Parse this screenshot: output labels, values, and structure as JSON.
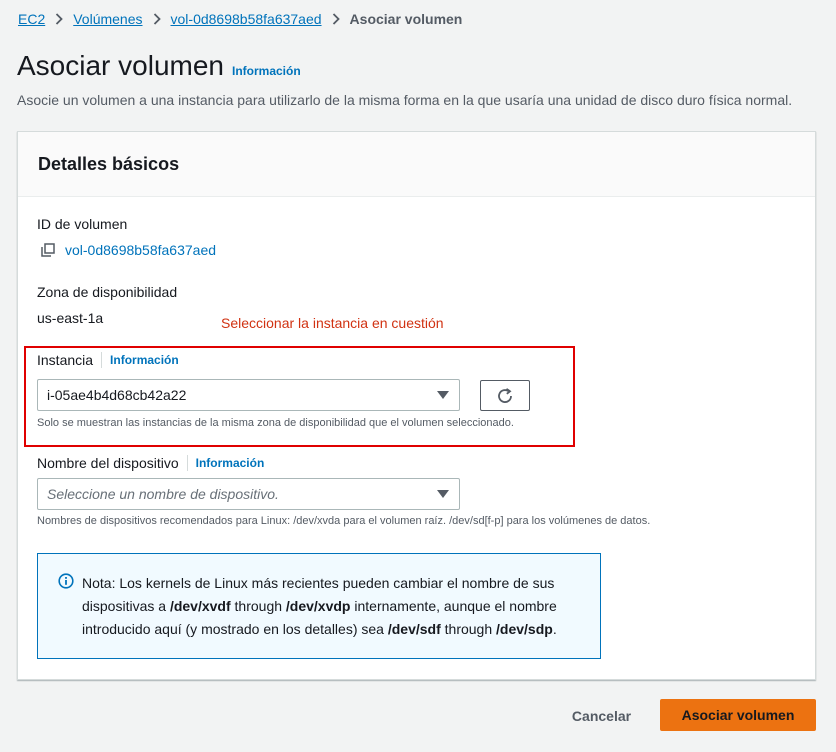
{
  "breadcrumb": {
    "items": [
      "EC2",
      "Volúmenes",
      "vol-0d8698b58fa637aed"
    ],
    "current": "Asociar volumen"
  },
  "header": {
    "title": "Asociar volumen",
    "info": "Información",
    "description": "Asocie un volumen a una instancia para utilizarlo de la misma forma en la que usaría una unidad de disco duro física normal."
  },
  "section": {
    "title": "Detalles básicos",
    "volume_id_label": "ID de volumen",
    "volume_id": "vol-0d8698b58fa637aed",
    "az_label": "Zona de disponibilidad",
    "az_value": "us-east-1a",
    "annotation": "Seleccionar la instancia en cuestión",
    "instance_label": "Instancia",
    "instance_info": "Información",
    "instance_value": "i-05ae4b4d68cb42a22",
    "instance_hint": "Solo se muestran las instancias de la misma zona de disponibilidad que el volumen seleccionado.",
    "device_label": "Nombre del dispositivo",
    "device_info": "Información",
    "device_placeholder": "Seleccione un nombre de dispositivo.",
    "device_hint": "Nombres de dispositivos recomendados para Linux: /dev/xvda para el volumen raíz. /dev/sd[f-p] para los volúmenes de datos."
  },
  "alert": {
    "t1": "Nota: Los kernels de Linux más recientes pueden cambiar el nombre de sus dispositivas a ",
    "b1": "/dev/xvdf",
    "t2": " through ",
    "b2": "/dev/xvdp",
    "t3": " internamente, aunque el nombre introducido aquí (y mostrado en los detalles) sea ",
    "b3": "/dev/sdf",
    "t4": " through ",
    "b4": "/dev/sdp",
    "t5": "."
  },
  "actions": {
    "cancel": "Cancelar",
    "submit": "Asociar volumen"
  },
  "colors": {
    "link": "#0073bb",
    "primary": "#ec7211",
    "annotation": "#d13212",
    "highlight_box": "#e00000"
  },
  "icons": [
    "chevron-right-icon",
    "copy-icon",
    "refresh-icon",
    "caret-down-icon",
    "info-circle-icon"
  ]
}
